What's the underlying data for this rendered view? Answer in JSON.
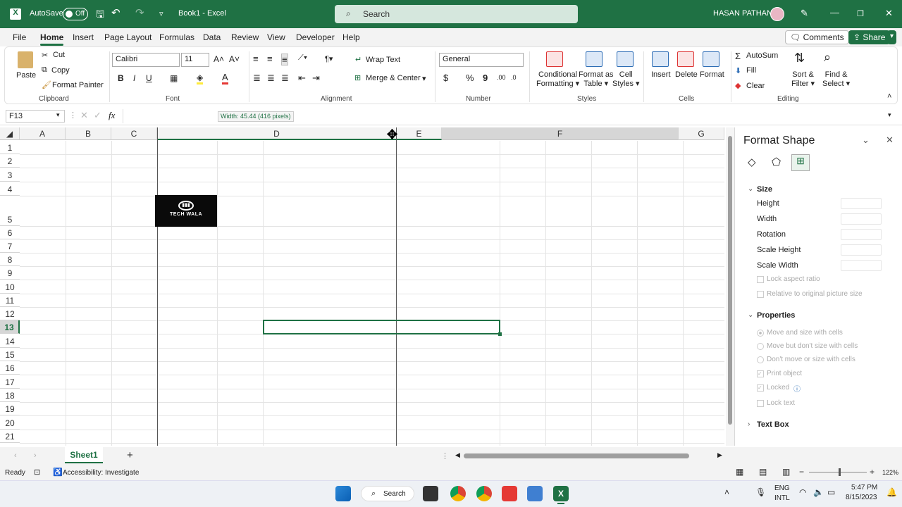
{
  "titlebar": {
    "autosave": "AutoSave",
    "toggle": "Off",
    "doc_title": "Book1  -  Excel",
    "search": "Search",
    "user": "HASAN PATHAN"
  },
  "menu": [
    "File",
    "Home",
    "Insert",
    "Page Layout",
    "Formulas",
    "Data",
    "Review",
    "View",
    "Developer",
    "Help"
  ],
  "header_buttons": {
    "comments": "Comments",
    "share": "Share"
  },
  "ribbon": {
    "clipboard": {
      "paste": "Paste",
      "cut": "Cut",
      "copy": "Copy",
      "format_painter": "Format Painter",
      "label": "Clipboard"
    },
    "font": {
      "family": "Calibri",
      "size": "11",
      "bold": "B",
      "italic": "I",
      "underline": "U",
      "label": "Font"
    },
    "alignment": {
      "wrap": "Wrap Text",
      "merge": "Merge & Center",
      "label": "Alignment"
    },
    "number": {
      "format": "General",
      "currency": "$",
      "percent": "%",
      "comma": "9",
      "label": "Number"
    },
    "styles": {
      "conditional1": "Conditional",
      "conditional2": "Formatting",
      "format_table1": "Format as",
      "format_table2": "Table",
      "cell_styles1": "Cell",
      "cell_styles2": "Styles",
      "label": "Styles"
    },
    "cells": {
      "insert": "Insert",
      "delete": "Delete",
      "format": "Format",
      "label": "Cells"
    },
    "editing": {
      "autosum": "AutoSum",
      "fill": "Fill",
      "clear": "Clear",
      "sort1": "Sort &",
      "sort2": "Filter",
      "find1": "Find &",
      "find2": "Select",
      "label": "Editing"
    }
  },
  "formula": {
    "namebox": "F13",
    "fx": "fx",
    "tooltip": "Width: 45.44 (416 pixels)"
  },
  "columns": [
    "A",
    "B",
    "C",
    "D",
    "E",
    "F",
    "G"
  ],
  "rows": [
    "1",
    "2",
    "3",
    "4",
    "5",
    "6",
    "7",
    "8",
    "9",
    "10",
    "11",
    "12",
    "13",
    "14",
    "15",
    "16",
    "17",
    "18",
    "19",
    "20",
    "21"
  ],
  "logo": {
    "text": "TECH WALA"
  },
  "pane": {
    "title": "Format Shape",
    "size_header": "Size",
    "height": "Height",
    "width": "Width",
    "rotation": "Rotation",
    "scale_height": "Scale Height",
    "scale_width": "Scale Width",
    "lock_aspect": "Lock aspect ratio",
    "relative": "Relative to original picture size",
    "properties_header": "Properties",
    "move_size": "Move and size with cells",
    "move_no_size": "Move but don't size with cells",
    "dont_move": "Don't move or size with cells",
    "print": "Print object",
    "locked": "Locked",
    "lock_text": "Lock text",
    "textbox": "Text Box"
  },
  "sheet": {
    "tab": "Sheet1"
  },
  "status": {
    "ready": "Ready",
    "accessibility": "Accessibility: Investigate",
    "zoom": "122%"
  },
  "taskbar": {
    "search": "Search",
    "lang1": "ENG",
    "lang2": "INTL",
    "time": "5:47 PM",
    "date": "8/15/2023"
  }
}
